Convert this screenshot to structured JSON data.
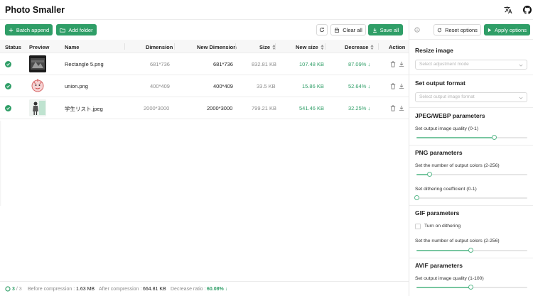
{
  "app": {
    "title": "Photo Smaller"
  },
  "header": {
    "translate_icon": "translate-icon",
    "github_icon": "github-icon"
  },
  "toolbar": {
    "batch_append": "Batch append",
    "add_folder": "Add folder",
    "refresh_icon": "refresh-icon",
    "clear_all": "Clear all",
    "save_all": "Save all"
  },
  "table": {
    "columns": [
      "Status",
      "Preview",
      "Name",
      "Dimension",
      "New Dimension",
      "Size",
      "New size",
      "Decrease",
      "Action"
    ],
    "rows": [
      {
        "name": "Rectangle 5.png",
        "dimension": "681*736",
        "new_dimension": "681*736",
        "size": "832.81 KB",
        "new_size": "107.48 KB",
        "decrease": "87.09%"
      },
      {
        "name": "union.png",
        "dimension": "400*409",
        "new_dimension": "400*409",
        "size": "33.5 KB",
        "new_size": "15.86 KB",
        "decrease": "52.64%"
      },
      {
        "name": "学生リスト.jpeg",
        "dimension": "2000*3000",
        "new_dimension": "2000*3000",
        "size": "799.21 KB",
        "new_size": "541.46 KB",
        "decrease": "32.25%"
      }
    ]
  },
  "footer": {
    "done": "3",
    "sep": "/",
    "total": "3",
    "before_label": "Before compression :",
    "before_value": "1.63 MB",
    "after_label": "After compression :",
    "after_value": "664.81 KB",
    "ratio_label": "Decrease ratio :",
    "ratio_value": "60.08%"
  },
  "panel": {
    "reset_options": "Reset options",
    "apply_options": "Apply options",
    "resize_title": "Resize image",
    "resize_placeholder": "Select adjustment mode",
    "format_title": "Set output format",
    "format_placeholder": "Select output image format",
    "jpeg_title": "JPEG/WEBP parameters",
    "jpeg_quality_label": "Set output image quality (0-1)",
    "jpeg_quality": 0.7,
    "png_title": "PNG parameters",
    "png_colors_label": "Set the number of output colors (2-256)",
    "png_colors": 0.12,
    "png_dither_label": "Set dithering coefficient (0-1)",
    "png_dither": 0.0,
    "gif_title": "GIF parameters",
    "gif_dither_label": "Turn on dithering",
    "gif_colors_label": "Set the number of output colors (2-256)",
    "gif_colors": 0.49,
    "avif_title": "AVIF parameters",
    "avif_quality_label": "Set output image quality (1-100)",
    "avif_quality": 0.49
  },
  "colors": {
    "accent": "#2f9e67",
    "accent_light": "#79c7a1",
    "border": "#d9d9d9"
  }
}
